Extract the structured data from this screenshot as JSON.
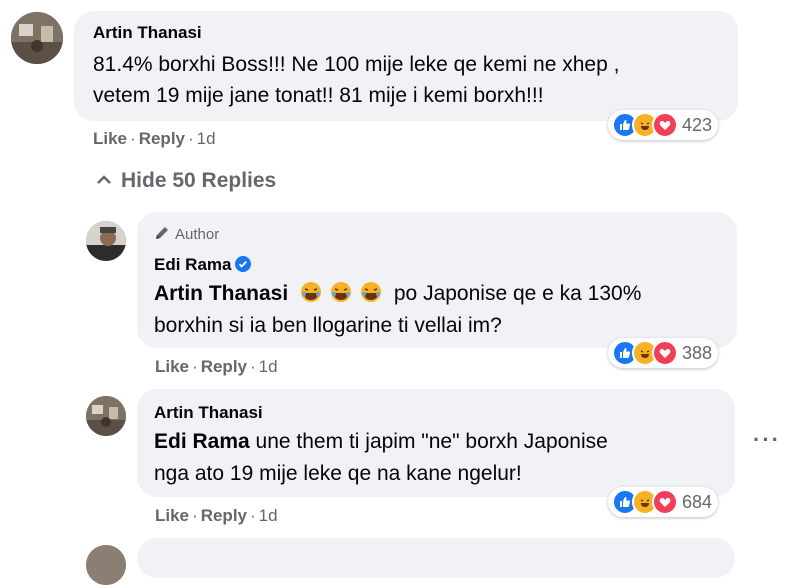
{
  "comment1": {
    "author": "Artin Thanasi",
    "line1": "81.4% borxhi Boss!!! Ne 100 mije leke qe kemi ne xhep ,",
    "line2": "vetem 19 mije jane tonat!! 81 mije i kemi borxh!!!",
    "like": "Like",
    "reply": "Reply",
    "time": "1d",
    "reaction_count": "423"
  },
  "hide_replies": "Hide 50 Replies",
  "reply1": {
    "badge": "Author",
    "author": "Edi Rama",
    "mention": "Artin Thanasi",
    "line1_rest": "po Japonise qe e ka 130%",
    "line2": "borxhin si ia ben llogarine ti vellai im?",
    "like": "Like",
    "reply": "Reply",
    "time": "1d",
    "reaction_count": "388"
  },
  "reply2": {
    "author": "Artin Thanasi",
    "mention": "Edi Rama",
    "line1_rest": "une them ti japim \"ne\" borxh Japonise",
    "line2": "nga ato 19 mije leke qe na kane ngelur!",
    "like": "Like",
    "reply": "Reply",
    "time": "1d",
    "reaction_count": "684"
  },
  "colors": {
    "bubble": "#f0f2f5",
    "like_blue": "#1877f2",
    "love_red": "#f33e58",
    "haha_yellow": "#f7b125",
    "secondary_text": "#65676b"
  },
  "icons": [
    "like-reaction-icon",
    "haha-reaction-icon",
    "love-reaction-icon",
    "chevron-up-icon",
    "pencil-icon",
    "verified-icon",
    "laughing-emoji-icon",
    "more-options-icon"
  ]
}
